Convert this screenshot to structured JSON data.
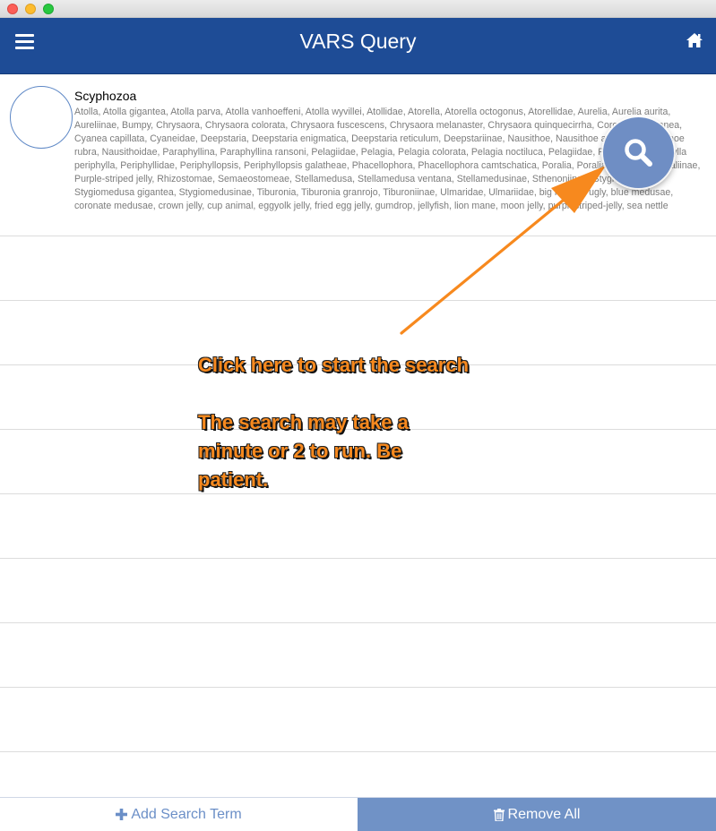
{
  "app": {
    "title": "VARS Query"
  },
  "icons": {
    "menu": "hamburger-menu-icon",
    "home": "home-icon",
    "search": "magnifier-icon",
    "add": "plus-icon",
    "remove": "trash-icon"
  },
  "results": [
    {
      "title": "Scyphozoa",
      "names": "Atolla, Atolla gigantea, Atolla parva, Atolla vanhoeffeni, Atolla wyvillei, Atollidae, Atorella, Atorella octogonus, Atorellidae, Aurelia, Aurelia aurita, Aureliinae, Bumpy, Chrysaora, Chrysaora colorata, Chrysaora fuscescens, Chrysaora melanaster, Chrysaora quinquecirrha, Coronatae, Cyanea, Cyanea capillata, Cyaneidae, Deepstaria, Deepstaria enigmatica, Deepstaria reticulum, Deepstariinae, Nausithoe, Nausithoe atlantica, Nausithoe rubra, Nausithoidae, Paraphyllina, Paraphyllina ransoni, Pelagiidae, Pelagia, Pelagia colorata, Pelagia noctiluca, Pelagiidae, Periphylla, Periphylla periphylla, Periphyllidae, Periphyllopsis, Periphyllopsis galatheae, Phacellophora, Phacellophora camtschatica, Poralia, Poralia rufescens, Poraliinae, Purple-striped jelly, Rhizostomae, Semaeostomeae, Stellamedusa, Stellamedusa ventana, Stellamedusinae, Sthenoniinae, Stygiomedusa, Stygiomedusa gigantea, Stygiomedusinae, Tiburonia, Tiburonia granrojo, Tiburoniinae, Ulmaridae, Ulmariidae, big red, big ugly, blue medusae, coronate medusae, crown jelly, cup animal, eggyolk jelly, fried egg jelly, gumdrop, jellyfish, lion mane, moon jelly, purplestriped-jelly, sea nettle"
    }
  ],
  "empty_row_count": 8,
  "annotation": {
    "line1": "Click here to start the search",
    "line2": "The search may take a minute or 2 to run. Be patient."
  },
  "footer": {
    "add_label": "Add Search Term",
    "remove_label": "Remove All"
  },
  "colors": {
    "header": "#1e4c96",
    "accent": "#6f8ec4",
    "remove_button": "#7092c6",
    "annotation": "#f7891e"
  }
}
